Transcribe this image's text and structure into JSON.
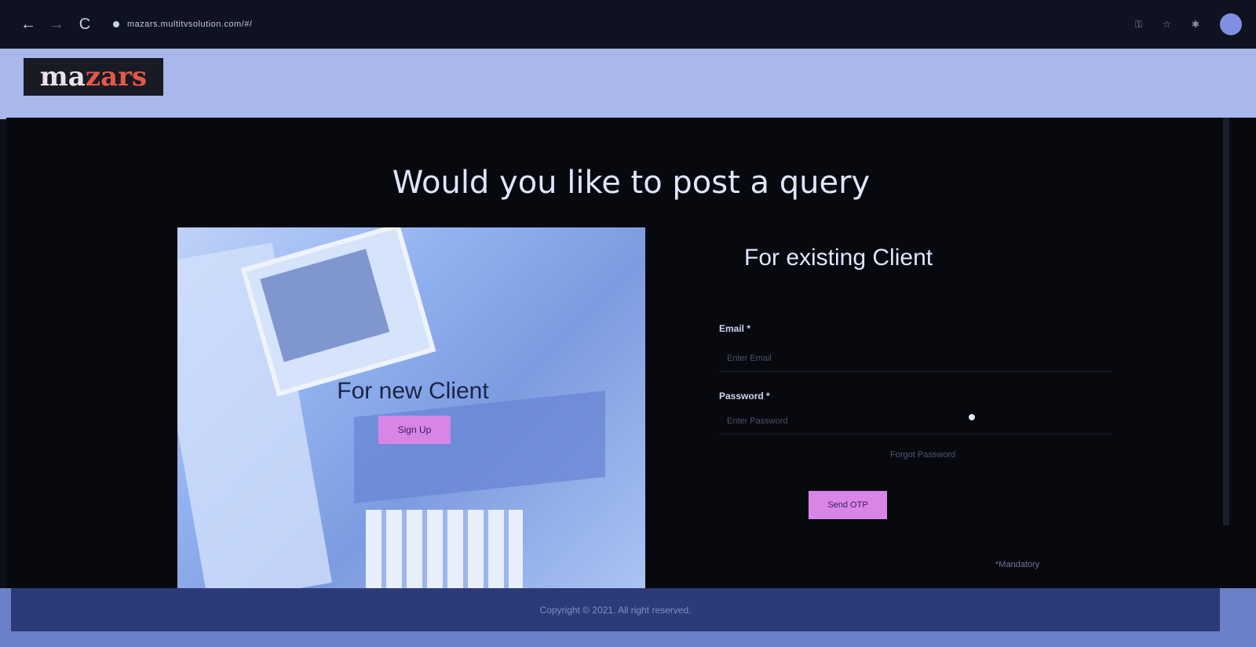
{
  "browser": {
    "url": "mazars.multitvsolution.com/#/",
    "back_icon": "←",
    "forward_icon": "→",
    "reload_icon": "C"
  },
  "header": {
    "logo_part1": "ma",
    "logo_part2": "zars"
  },
  "main": {
    "title": "Would you like to post a query"
  },
  "new_client": {
    "title": "For new Client",
    "signup_label": "Sign Up"
  },
  "existing_client": {
    "title": "For existing Client",
    "email_label": "Email *",
    "email_placeholder": "Enter Email",
    "password_label": "Password *",
    "password_placeholder": "Enter Password",
    "forgot_label": "Forgot Password",
    "send_otp_label": "Send OTP",
    "mandatory_note": "*Mandatory"
  },
  "footer": {
    "copyright": "Copyright © 2021. All right reserved."
  },
  "colors": {
    "accent_button": "#d985e8",
    "header_bg": "#a9b7ea",
    "footer_bg": "#2c3a78"
  }
}
